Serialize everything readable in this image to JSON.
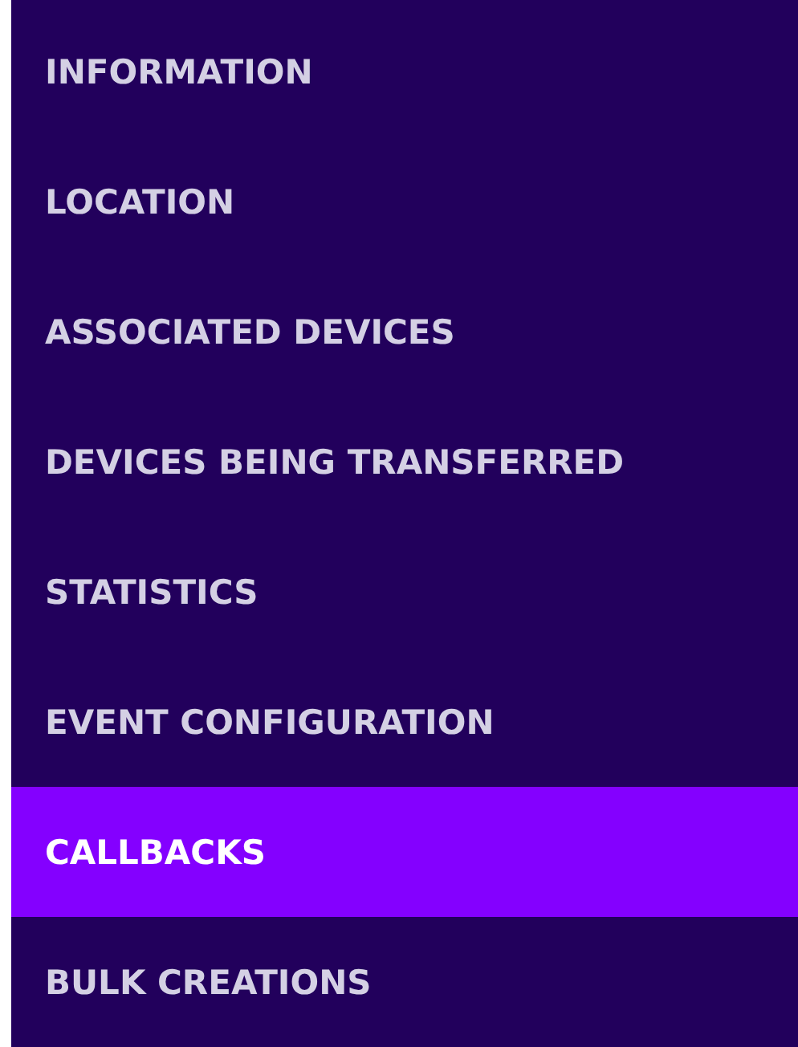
{
  "menu": {
    "items": [
      {
        "label": "INFORMATION",
        "selected": false
      },
      {
        "label": "LOCATION",
        "selected": false
      },
      {
        "label": "ASSOCIATED DEVICES",
        "selected": false
      },
      {
        "label": "DEVICES BEING TRANSFERRED",
        "selected": false
      },
      {
        "label": "STATISTICS",
        "selected": false
      },
      {
        "label": "EVENT CONFIGURATION",
        "selected": false
      },
      {
        "label": "CALLBACKS",
        "selected": true
      },
      {
        "label": "BULK CREATIONS",
        "selected": false
      }
    ]
  }
}
